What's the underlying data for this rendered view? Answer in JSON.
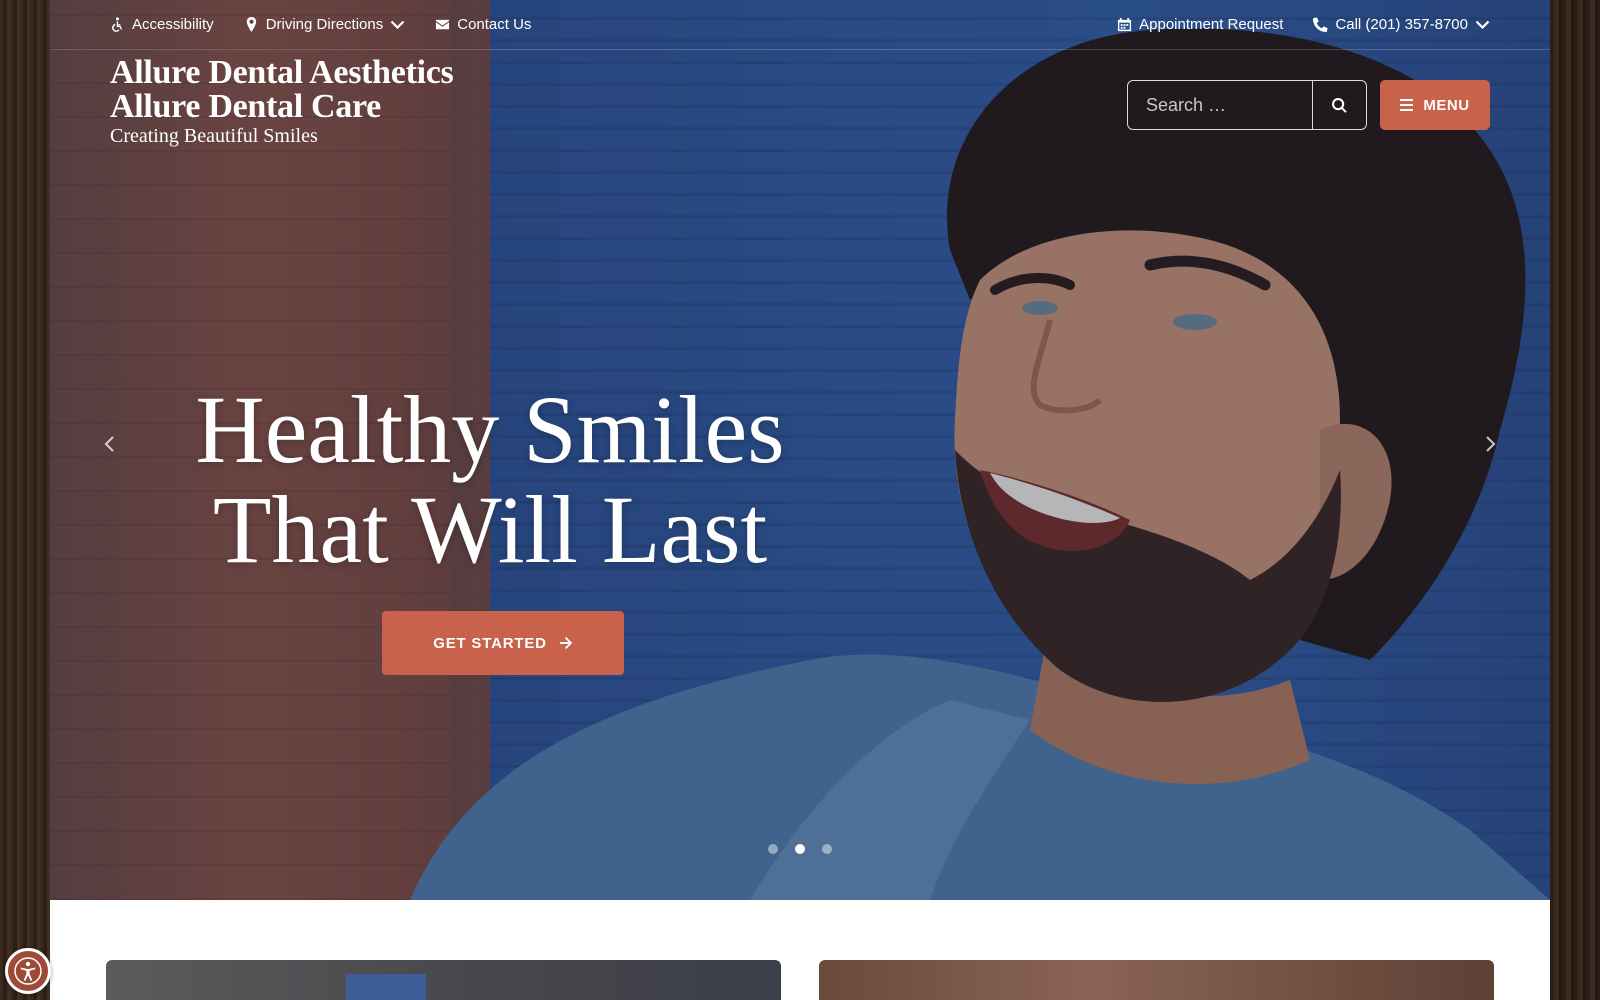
{
  "topbar": {
    "accessibility": "Accessibility",
    "directions": "Driving Directions",
    "contact": "Contact Us",
    "appointment": "Appointment Request",
    "call": "Call (201) 357-8700"
  },
  "logo": {
    "line1": "Allure Dental Aesthetics",
    "line2": "Allure Dental Care",
    "tagline": "Creating Beautiful Smiles"
  },
  "search": {
    "placeholder": "Search …"
  },
  "menu": {
    "label": "MENU"
  },
  "hero": {
    "headline_line1": "Healthy Smiles",
    "headline_line2": "That Will Last",
    "cta_label": "GET STARTED",
    "slides_total": 3,
    "active_slide": 2
  },
  "colors": {
    "accent": "#c8624a",
    "hero_blue": "#2f5599"
  },
  "icons": [
    "wheelchair-icon",
    "map-pin-icon",
    "envelope-icon",
    "calendar-icon",
    "phone-icon",
    "search-icon",
    "hamburger-icon",
    "arrow-right-icon",
    "chevron-left-icon",
    "chevron-right-icon",
    "chevron-down-icon",
    "accessibility-widget-icon"
  ]
}
